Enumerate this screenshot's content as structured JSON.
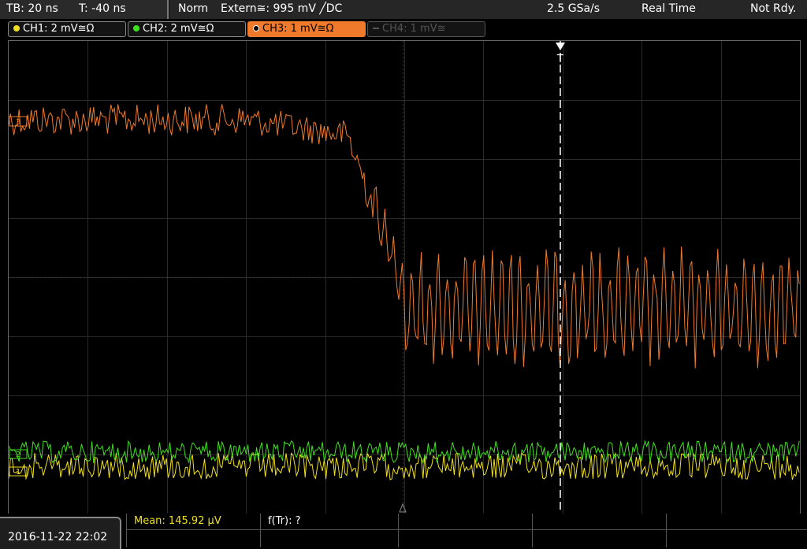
{
  "status": {
    "timebase": "TB: 20 ns",
    "trigger_time": "T: -40 ns",
    "trigger_mode": "Norm",
    "trigger_source": "Extern≅: 995 mV ╱DC",
    "sample_rate": "2.5 GSa/s",
    "acquisition": "Real Time",
    "state": "Not Rdy."
  },
  "channels": [
    {
      "label": "CH1: 2 mV≅Ω",
      "color": "#f0e020"
    },
    {
      "label": "CH2: 2 mV≅Ω",
      "color": "#40e020"
    },
    {
      "label": "CH3: 1 mV≅Ω",
      "color": "#f07a2c"
    },
    {
      "label": "CH4: 1 mV≅",
      "color": "#555555"
    }
  ],
  "markers": {
    "trigger": "T",
    "ch3_ref": "3",
    "ch1_ref": "1",
    "ch2_ref": "2"
  },
  "footer": {
    "datetime": "2016-11-22 22:02",
    "mean_label": "Mean: 145.92 µV",
    "ftr_label": "f(Tr): ?"
  }
}
